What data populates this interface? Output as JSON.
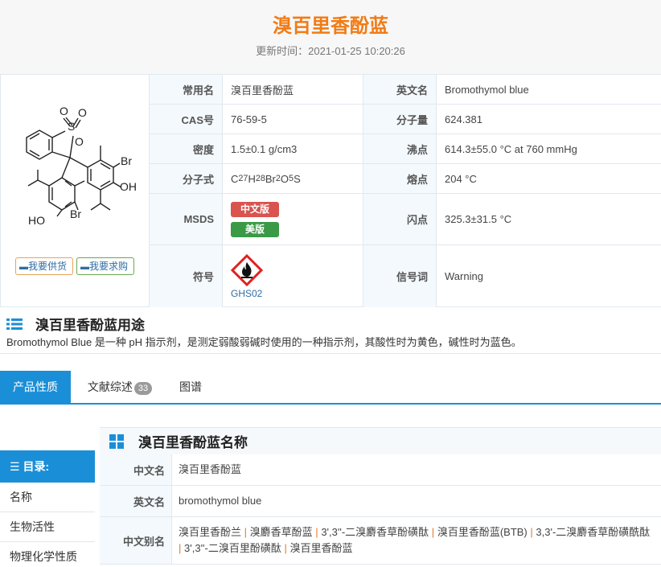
{
  "header": {
    "title": "溴百里香酚蓝",
    "updated": "更新时间：2021-01-25 10:20:26"
  },
  "structure_labels": {
    "s": "S",
    "o1": "O",
    "o2": "O",
    "o3": "O",
    "br1": "Br",
    "oh1": "OH",
    "ho2": "HO",
    "br2": "Br"
  },
  "actions": {
    "supply": "我要供货",
    "buy": "我要求购"
  },
  "properties": {
    "common_name_label": "常用名",
    "common_name": "溴百里香酚蓝",
    "english_name_label": "英文名",
    "english_name": "Bromothymol blue",
    "cas_label": "CAS号",
    "cas": "76-59-5",
    "mw_label": "分子量",
    "mw": "624.381",
    "density_label": "密度",
    "density": "1.5±0.1 g/cm3",
    "bp_label": "沸点",
    "bp": "614.3±55.0 °C at 760 mmHg",
    "formula_label": "分子式",
    "formula": [
      "C",
      "27",
      "H",
      "28",
      "Br",
      "2",
      "O",
      "5",
      "S"
    ],
    "mp_label": "熔点",
    "mp": "204 °C",
    "msds_label": "MSDS",
    "msds_cn": "中文版",
    "msds_us": "美版",
    "fp_label": "闪点",
    "fp": "325.3±31.5 °C",
    "symbol_label": "符号",
    "ghs": "GHS02",
    "signal_label": "信号词",
    "signal": "Warning"
  },
  "usage": {
    "title": "溴百里香酚蓝用途",
    "text": "Bromothymol Blue 是一种 pH 指示剂，是测定弱酸弱碱时使用的一种指示剂，其酸性时为黄色，碱性时为蓝色。"
  },
  "tabs": {
    "t1": "产品性质",
    "t2": "文献综述",
    "t2_count": "33",
    "t3": "图谱"
  },
  "toc": {
    "head": "目录:",
    "items": [
      "名称",
      "生物活性",
      "物理化学性质"
    ]
  },
  "names": {
    "title": "溴百里香酚蓝名称",
    "cn_label": "中文名",
    "cn": "溴百里香酚蓝",
    "en_label": "英文名",
    "en": "bromothymol blue",
    "alias_label": "中文别名",
    "aliases": [
      "溴百里香酚兰",
      "溴麝香草酚蓝",
      "3',3''-二溴麝香草酚磺酞",
      "溴百里香酚蓝(BTB)",
      "3,3'-二溴麝香草酚磺酰酞",
      "3',3''-二溴百里酚磺酞",
      "溴百里香酚蓝"
    ]
  },
  "colors": {
    "title": "#f27b14",
    "accent": "#1a8fd8",
    "msds_cn": "#d9534f",
    "msds_us": "#3a9a45",
    "ghs_red": "#e02020"
  }
}
